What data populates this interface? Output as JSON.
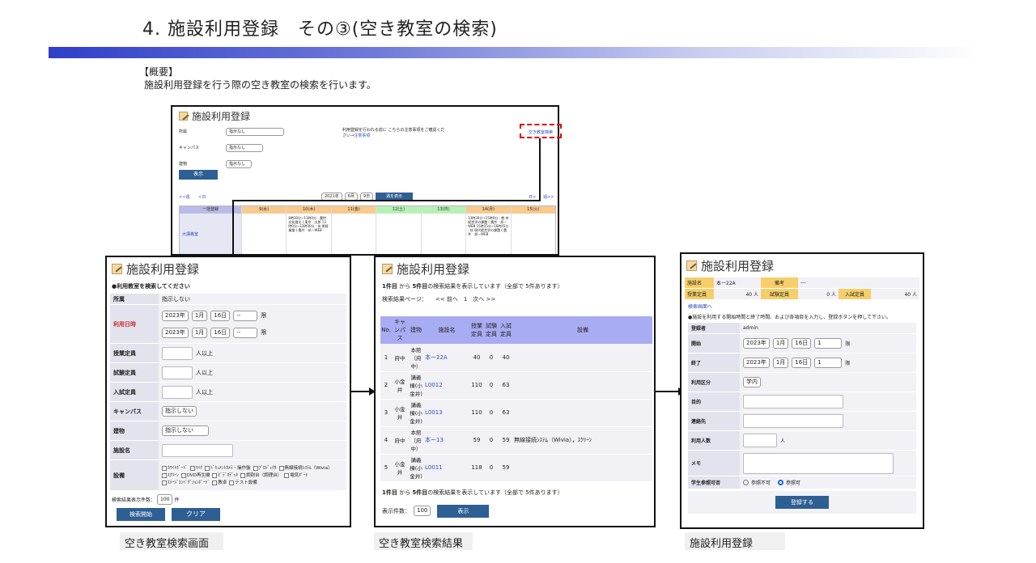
{
  "slide": {
    "title": "4. 施設利用登録　その③(空き教室の検索)",
    "overview_heading": "【概要】",
    "overview_text": "施設利用登録を行う際の空き教室の検索を行います。"
  },
  "top_shot": {
    "title": "施設利用登録",
    "f_shozoku": "所属",
    "f_campus": "キャンパス",
    "f_tatemono": "建物",
    "select_none": "指示なし",
    "notice": "利用登録を行われる前に こちらの注意事項をご確認ください→",
    "notice_link": "注意事項",
    "vacant_link": "空き教室検索",
    "show_button": "表示",
    "prev_week": "<<週",
    "prev_day": "<日",
    "next_day": "日>",
    "next_week": "週>>",
    "date_year": "2021年",
    "date_month": "6月",
    "date_day": "9日",
    "week_button": "週を表示",
    "grid_head": "一括登録",
    "days": [
      "9(水)",
      "10(木)",
      "11(金)",
      "12(土)",
      "13(日)",
      "14(月)",
      "15(火)"
    ],
    "room": "大講義室",
    "cell_thu": "8時30分~11時0分 : 農特 交化論文 ( 東京　太郎 13時0分~12時30分 : 技 術経業論 ( 農井　邦一WEB",
    "cell_mon": "13時30分~15時0分 : 教 材経営学の課題 ( 農井　邦一WEB 15時15分~16時45分 : 技 現代経営学の課題 ( 農井　邦一WEB"
  },
  "search": {
    "title": "施設利用登録",
    "intro": "●利用教室を検索してください",
    "shozoku_label": "所属",
    "shozoku_value": "指示しない",
    "date_label": "利用日時",
    "year": "2023年",
    "month": "1月",
    "day": "16日",
    "hour": "--",
    "gen": "限",
    "jugyo_label": "授業定員",
    "shiken_label": "試験定員",
    "nyushi_label": "入試定員",
    "ijou": "人以上",
    "campus_label": "キャンパス",
    "campus_value": "指示しない",
    "tatemono_label": "建物",
    "tatemono_value": "指示しない",
    "shisetsu_label": "施設名",
    "setsubi_label": "設備",
    "equipment": [
      "ﾎﾜｲﾄﾎﾞｰﾄﾞ",
      "ﾏｲｸ",
      "ﾄﾞｷｭﾒﾝﾄｶﾒﾗ・操作盤",
      "ﾌﾟﾛｼﾞｪｸﾀ",
      "無線接続ｼｽﾃﾑ（Wivia）",
      "ｽｸﾘｰﾝ",
      "DVD再生機",
      "ﾋﾞﾃﾞｵﾃﾞｯｷ",
      "調剤台（調理台）",
      "電気ﾎﾟｰﾄ",
      "ｽﾃｰｼﾞｺﾝﾍﾞｸﾞｼｮﾝﾎﾞｰﾄﾞ",
      "教卓",
      "テスト設備"
    ],
    "count_label": "検索結果表示件数：",
    "count_value": "100",
    "count_unit": "件",
    "search_button": "検索開始",
    "clear_button": "クリア",
    "caption": "空き教室検索画面"
  },
  "results": {
    "title": "施設利用登録",
    "summary_pre": "1件目",
    "summary_mid": "から",
    "summary_bold": "5件目",
    "summary_post": "の検索結果を表示しています（全部で 5件あります）",
    "paging_label": "検索結果ページ：",
    "paging": "<< 前へ　1　次へ >>",
    "headers": [
      "No.",
      "キャンパス",
      "建物",
      "施設名",
      "授業定員",
      "試験定員",
      "入試定員",
      "設備"
    ],
    "rows": [
      {
        "no": "1",
        "campus": "府中",
        "building": "本館（府中）",
        "name": "本ー22A",
        "jugyo": "40",
        "shiken": "0",
        "nyushi": "40",
        "equip": ""
      },
      {
        "no": "2",
        "campus": "小金井",
        "building": "講義棟(小金井)",
        "name": "L0012",
        "jugyo": "110",
        "shiken": "0",
        "nyushi": "63",
        "equip": ""
      },
      {
        "no": "3",
        "campus": "小金井",
        "building": "講義棟(小金井)",
        "name": "L0013",
        "jugyo": "110",
        "shiken": "0",
        "nyushi": "63",
        "equip": ""
      },
      {
        "no": "4",
        "campus": "府中",
        "building": "本館（府中）",
        "name": "本ー13",
        "jugyo": "59",
        "shiken": "0",
        "nyushi": "59",
        "equip": "無線接続ｼｽﾃﾑ（Wivia），ｽｸﾘｰﾝ"
      },
      {
        "no": "5",
        "campus": "小金井",
        "building": "講義棟(小金井)",
        "name": "L0011",
        "jugyo": "118",
        "shiken": "0",
        "nyushi": "59",
        "equip": ""
      }
    ],
    "count_label": "表示件数：",
    "count_value": "100",
    "show_button": "表示",
    "caption": "空き教室検索結果"
  },
  "register": {
    "title": "施設利用登録",
    "shisetsu_label": "施設名",
    "shisetsu_value": "本ー22A",
    "biko_label": "備考",
    "biko_value": "---",
    "jugyo_label": "授業定員",
    "jugyo_value": "40 人",
    "shiken_label": "試験定員",
    "shiken_value": "0 人",
    "nyushi_label": "入試定員",
    "nyushi_value": "40 人",
    "back_link": "検索画面へ",
    "intro": "●施設を利用する開始時間と終了時間、および各項目を入力し、登録ボタンを押して下さい。",
    "user_label": "登録者",
    "user_value": "admin",
    "start_label": "開始",
    "end_label": "終了",
    "year": "2023年",
    "month": "1月",
    "day": "16日",
    "period": "1",
    "gen": "限",
    "kubun_label": "利用区分",
    "kubun_value": "学内",
    "purpose_label": "目的",
    "contact_label": "連絡先",
    "people_label": "利用人数",
    "people_unit": "人",
    "memo_label": "メモ",
    "student_label": "学生参照可否",
    "opt_no": "参照不可",
    "opt_yes": "参照可",
    "register_button": "登録する",
    "caption": "施設利用登録"
  }
}
